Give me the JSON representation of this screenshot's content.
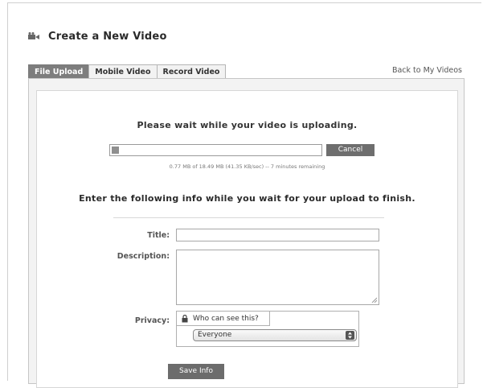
{
  "header": {
    "title": "Create a New Video",
    "icon": "video-camera-icon"
  },
  "tabs": [
    {
      "label": "File Upload",
      "active": true
    },
    {
      "label": "Mobile Video",
      "active": false
    },
    {
      "label": "Record Video",
      "active": false
    }
  ],
  "back_link": "Back to My Videos",
  "upload": {
    "wait_message": "Please wait while your video is uploading.",
    "progress_percent": 4,
    "cancel_label": "Cancel",
    "status": "0.77 MB of 18.49 MB (41.35 KB/sec) -- 7 minutes remaining"
  },
  "form": {
    "intro": "Enter the following info while you wait for your upload to finish.",
    "title_label": "Title:",
    "title_value": "",
    "description_label": "Description:",
    "description_value": "",
    "privacy_label": "Privacy:",
    "privacy_prompt": "Who can see this?",
    "privacy_selected": "Everyone",
    "save_label": "Save Info"
  },
  "colors": {
    "tab_active": "#7d7d7d",
    "button": "#6c6c6c",
    "panel": "#f3f3f3"
  }
}
